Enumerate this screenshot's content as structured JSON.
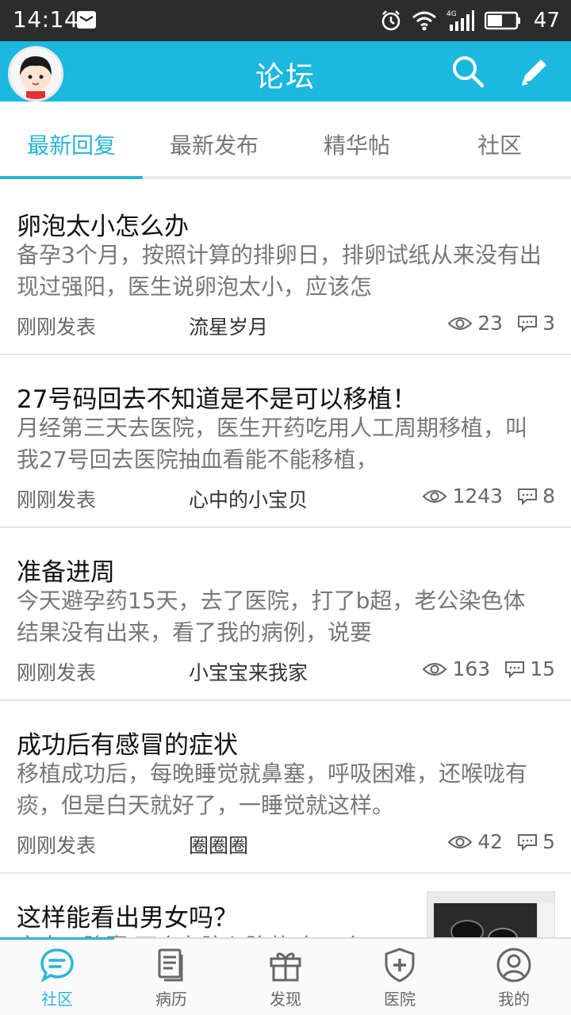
{
  "status_bar": {
    "time": "14:14",
    "battery": "47",
    "icons": [
      "mail-icon",
      "alarm-icon",
      "wifi-icon",
      "signal-4g-icon",
      "battery-icon"
    ]
  },
  "header": {
    "title": "论坛",
    "accent_color": "#1bb8e0"
  },
  "tabs": [
    {
      "label": "最新回复",
      "active": true
    },
    {
      "label": "最新发布",
      "active": false
    },
    {
      "label": "精华帖",
      "active": false
    },
    {
      "label": "社区",
      "active": false
    }
  ],
  "posts": [
    {
      "title": "卵泡太小怎么办",
      "excerpt": "备孕3个月，按照计算的排卵日，排卵试纸从来没有出现过强阳，医生说卵泡太小，应该怎",
      "time": "刚刚发表",
      "author": "流星岁月",
      "views": "23",
      "comments": "3"
    },
    {
      "title": "27号码回去不知道是不是可以移植！",
      "excerpt": "月经第三天去医院，医生开药吃用人工周期移植，叫我27号回去医院抽血看能不能移植，",
      "time": "刚刚发表",
      "author": "心中的小宝贝",
      "views": "1243",
      "comments": "8"
    },
    {
      "title": "准备进周",
      "excerpt": "今天避孕药15天，去了医院，打了b超，老公染色体结果没有出来，看了我的病例，说要",
      "time": "刚刚发表",
      "author": "小宝宝来我家",
      "views": "163",
      "comments": "15"
    },
    {
      "title": "成功后有感冒的症状",
      "excerpt": "移植成功后，每晚睡觉就鼻塞，呼吸困难，还喉咙有痰，但是白天就好了，一睡觉就这样。",
      "time": "刚刚发表",
      "author": "圈圈圈",
      "views": "42",
      "comments": "5"
    },
    {
      "title": "这样能看出男女吗？",
      "excerpt": "宫内三胎囊 两个有胎心胎芽 有一个",
      "time": "",
      "author": "",
      "views": "",
      "comments": ""
    }
  ],
  "bottom_nav": [
    {
      "label": "社区",
      "icon": "chat-bubble-icon",
      "active": true
    },
    {
      "label": "病历",
      "icon": "document-icon",
      "active": false
    },
    {
      "label": "发现",
      "icon": "gift-icon",
      "active": false
    },
    {
      "label": "医院",
      "icon": "shield-plus-icon",
      "active": false
    },
    {
      "label": "我的",
      "icon": "user-circle-icon",
      "active": false
    }
  ]
}
